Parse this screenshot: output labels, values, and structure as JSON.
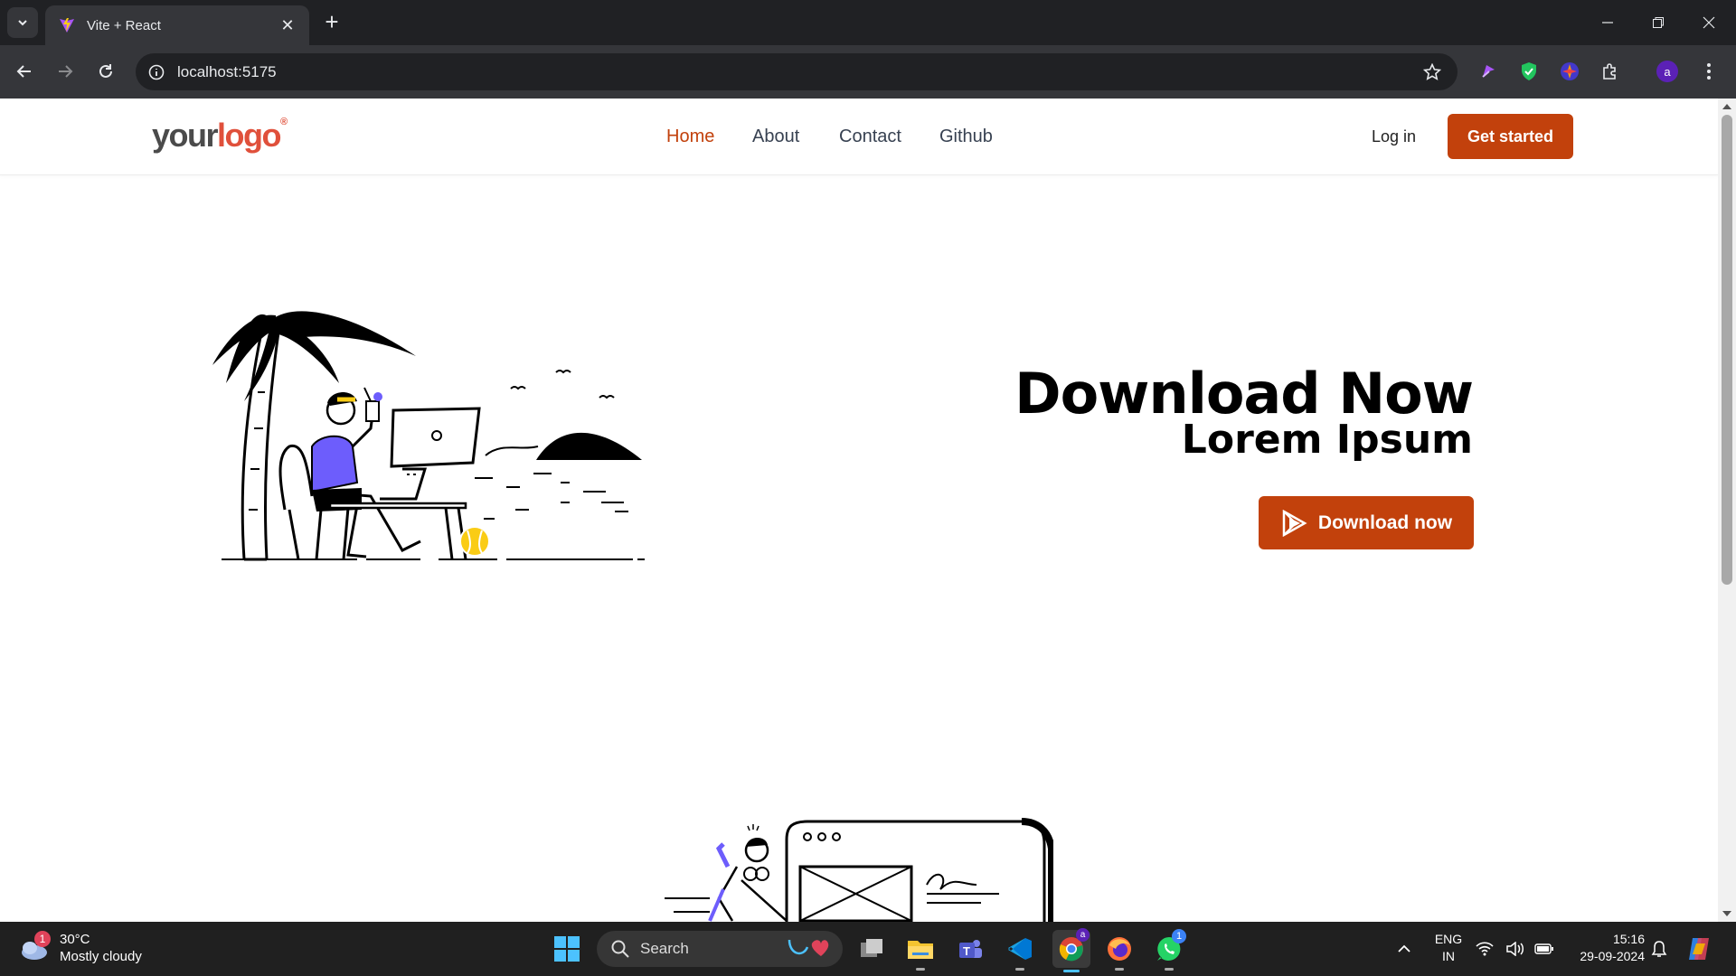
{
  "browser": {
    "tab_title": "Vite + React",
    "url": "localhost:5175",
    "profile_initial": "a"
  },
  "site": {
    "logo_your": "your",
    "logo_logo": "logo",
    "logo_mark": "®",
    "nav": [
      "Home",
      "About",
      "Contact",
      "Github"
    ],
    "active_nav": "Home",
    "login_label": "Log in",
    "cta_label": "Get started",
    "hero_title": "Download Now",
    "hero_subtitle": "Lorem Ipsum",
    "download_label": "Download now",
    "accent": "#c2410c"
  },
  "taskbar": {
    "weather_temp": "30°C",
    "weather_desc": "Mostly cloudy",
    "weather_badge": "1",
    "search_placeholder": "Search",
    "lang_line1": "ENG",
    "lang_line2": "IN",
    "time": "15:16",
    "date": "29-09-2024",
    "chrome_badge": "a",
    "whatsapp_badge": "1"
  }
}
